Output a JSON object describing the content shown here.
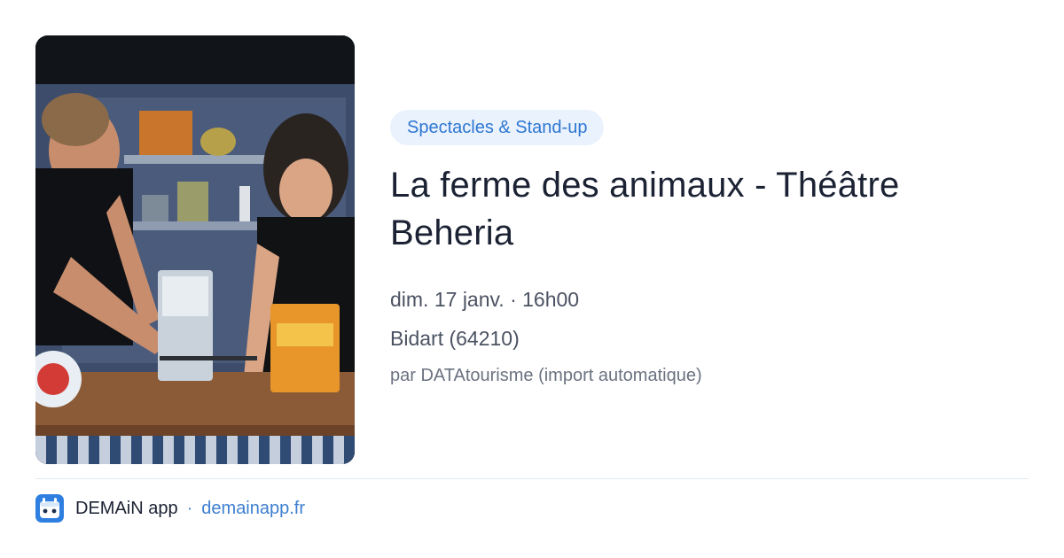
{
  "event": {
    "category": "Spectacles & Stand-up",
    "title": "La ferme des animaux - Théâtre Beheria",
    "datetime": "dim. 17 janv. · 16h00",
    "location": "Bidart (64210)",
    "source": "par DATAtourisme (import automatique)",
    "photo_alt": "La ferme des animaux"
  },
  "footer": {
    "brand": "DEMAiN app",
    "separator": "·",
    "domain": "demainapp.fr"
  },
  "colors": {
    "chip_bg": "#eaf2fd",
    "chip_text": "#2f77d1",
    "link": "#3d7fd0",
    "divider": "#dfe7ee"
  },
  "icons": {
    "logo": "demain-app-logo-icon"
  }
}
